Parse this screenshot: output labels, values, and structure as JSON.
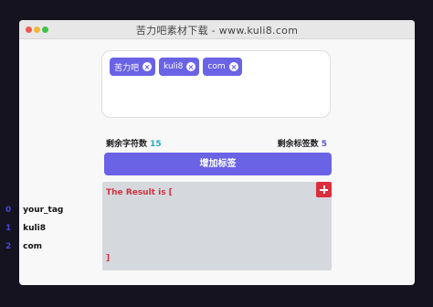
{
  "window": {
    "title": "苦力吧素材下载 - www.kuli8.com"
  },
  "tag_input": {
    "tags": [
      {
        "label": "苦力吧"
      },
      {
        "label": "kuli8"
      },
      {
        "label": "com"
      }
    ],
    "value": ""
  },
  "counters": {
    "chars_label": "剩余字符数",
    "chars_value": "15",
    "tags_label": "剩余标签数",
    "tags_value": "5"
  },
  "add_button": {
    "label": "增加标签"
  },
  "result": {
    "heading": "The Result is [",
    "close": "]",
    "items": [
      {
        "index": "0",
        "value": "your_tag"
      },
      {
        "index": "1",
        "value": "kuli8"
      },
      {
        "index": "2",
        "value": "com"
      }
    ]
  },
  "colors": {
    "accent": "#6a63e6",
    "danger": "#db2d3a",
    "teal": "#2aa9c9"
  }
}
